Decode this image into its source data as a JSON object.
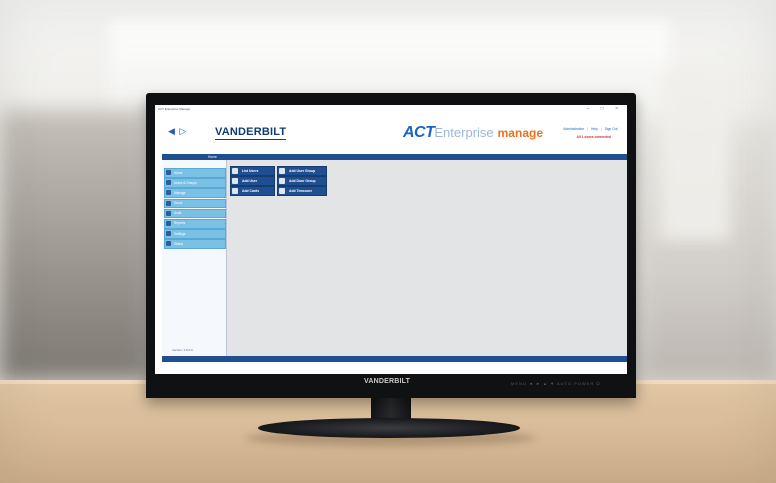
{
  "window": {
    "title": "ACT Enterprise Manage",
    "controls": "– □ ×"
  },
  "header": {
    "nav_arrows": "◀ ▷",
    "logo_text": "VANDERBILT",
    "product_act": "ACT",
    "product_enterprise": "Enterprise",
    "product_manage": "manage",
    "links": [
      "Administration",
      "Help",
      "Sign Out"
    ],
    "status": "All 1 doors connected"
  },
  "sidebar": {
    "home_label": "Home",
    "items": [
      {
        "label": "Home",
        "icon": "home-icon"
      },
      {
        "label": "Users & Groups",
        "icon": "users-icon"
      },
      {
        "label": "Manage",
        "icon": "manage-icon"
      },
      {
        "label": "Doors",
        "icon": "door-icon"
      },
      {
        "label": "Audit",
        "icon": "audit-icon"
      },
      {
        "label": "Reports",
        "icon": "reports-icon"
      },
      {
        "label": "Settings",
        "icon": "settings-icon"
      },
      {
        "label": "Status",
        "icon": "status-icon"
      }
    ],
    "version": "Version: 2.8.0.6"
  },
  "quick_actions": [
    {
      "label": "List Users",
      "icon": "user-list-icon"
    },
    {
      "label": "Add User",
      "icon": "add-user-icon"
    },
    {
      "label": "Add Cards",
      "icon": "card-icon"
    },
    {
      "label": "Add User Group",
      "icon": "user-group-icon"
    },
    {
      "label": "Add Door Group",
      "icon": "door-group-icon"
    },
    {
      "label": "Add Timezone",
      "icon": "clock-icon"
    }
  ],
  "monitor": {
    "brand": "VANDERBILT",
    "chin_buttons": "MENU  ◄ ►  ▲ ▼  AUTO  POWER  ⏻"
  },
  "colors": {
    "accent": "#1f4f91",
    "act_blue": "#1b64c6",
    "manage_orange": "#e8731b",
    "sidebar_item": "#7bc1e6",
    "status_red": "#d12a2a"
  }
}
